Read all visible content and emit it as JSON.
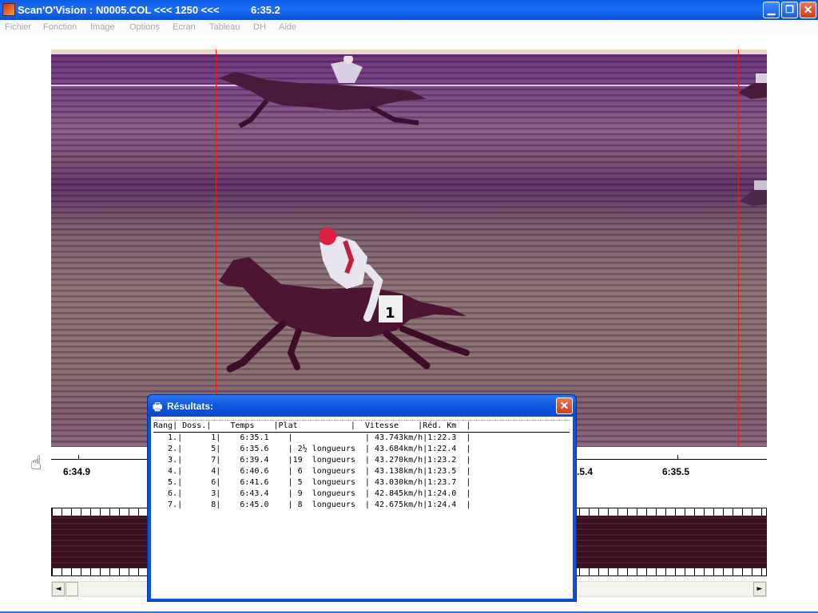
{
  "window": {
    "title_app": "Scan'O'Vision :",
    "title_file": "N0005.COL <<< 1250 <<<",
    "title_time": "6:35.2",
    "min_label": "▁",
    "restore_label": "❐",
    "close_label": "✕"
  },
  "menu": [
    "Fichier",
    "Fonction",
    "Image",
    "Options",
    "Ecran",
    "Tableau",
    "DH",
    "Aide"
  ],
  "timeline": {
    "labels": [
      "6:34.9",
      ".5.4",
      "6:35.5"
    ]
  },
  "results_dialog": {
    "title": "Résultats:",
    "icon": "printer-icon",
    "close_label": "✕",
    "header": "Rang| Doss.|    Temps    |Plat           |  Vitesse    |Réd. Km  |",
    "rows": [
      "   1.|      1|    6:35.1    |               | 43.743km/h|1:22.3  |",
      "   2.|      5|    6:35.6    | 2½ longueurs  | 43.684km/h|1:22.4  |",
      "   3.|      7|    6:39.4    |19  longueurs  | 43.270km/h|1:23.2  |",
      "   4.|      4|    6:40.6    | 6  longueurs  | 43.138km/h|1:23.5  |",
      "   5.|      6|    6:41.6    | 5  longueurs  | 43.030km/h|1:23.7  |",
      "   6.|      3|    6:43.4    | 9  longueurs  | 42.845km/h|1:24.0  |",
      "   7.|      8|    6:45.0    | 8  longueurs  | 42.675km/h|1:24.4  |"
    ]
  },
  "saddle_number": "1",
  "scroll": {
    "left_arrow": "◄",
    "right_arrow": "►"
  },
  "colors": {
    "titlebar": "#0a5ce6",
    "finish_line": "#e02020",
    "photo_tint": "#7a5078"
  }
}
